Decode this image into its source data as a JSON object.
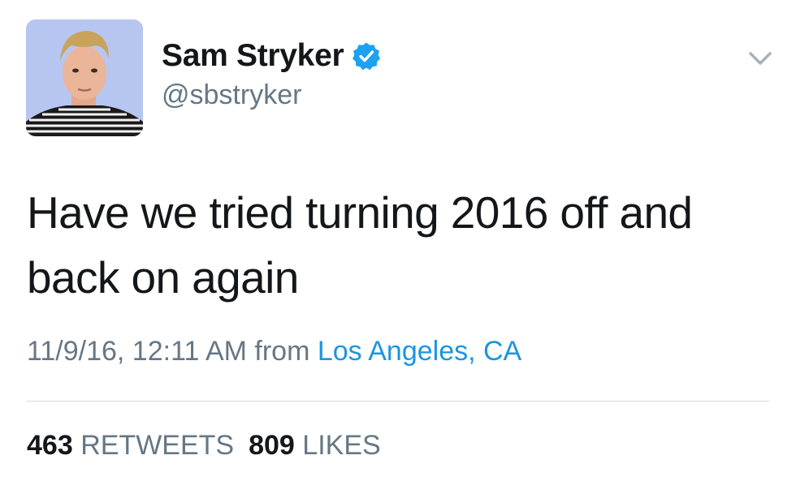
{
  "author": {
    "display_name": "Sam Stryker",
    "handle": "@sbstryker",
    "verified": true,
    "avatar_icon": "profile-photo",
    "verified_icon": "verified-badge-icon"
  },
  "tweet": {
    "text": "Have we tried turning 2016 off and back on again",
    "timestamp": "11/9/16, 12:11 AM",
    "from_label": "from",
    "location": "Los Angeles, CA"
  },
  "stats": {
    "retweets_count": "463",
    "retweets_label": "RETWEETS",
    "likes_count": "809",
    "likes_label": "LIKES"
  },
  "menu": {
    "icon": "chevron-down-icon"
  },
  "colors": {
    "text_primary": "#14171a",
    "text_secondary": "#657786",
    "link": "#1b95e0",
    "verified": "#1da1f2",
    "divider": "#d6d9dc"
  }
}
